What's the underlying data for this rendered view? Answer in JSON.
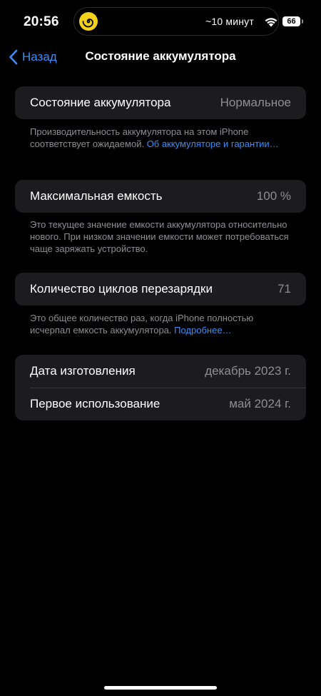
{
  "status_bar": {
    "time": "20:56",
    "timer_text": "~10 минут",
    "battery_level": "66",
    "island_icon": "spiral-icon",
    "wifi_icon": "wifi-icon"
  },
  "nav": {
    "back_label": "Назад",
    "back_icon": "chevron-left-icon",
    "title": "Состояние аккумулятора"
  },
  "battery_state": {
    "label": "Состояние аккумулятора",
    "value": "Нормальное",
    "footer_text": "Производительность аккумулятора на этом iPhone соответствует ожидаемой. ",
    "footer_link": "Об аккумуляторе и гарантии…"
  },
  "max_capacity": {
    "label": "Максимальная емкость",
    "value": "100 %",
    "footer_text": "Это текущее значение емкости аккумулятора относительно нового. При низком значении емкости может потребоваться чаще заряжать устройство."
  },
  "cycle_count": {
    "label": "Количество циклов перезарядки",
    "value": "71",
    "footer_text": "Это общее количество раз, когда iPhone полностью исчерпал емкость аккумулятора. ",
    "footer_link": "Подробнее…"
  },
  "dates": {
    "manufacture_label": "Дата изготовления",
    "manufacture_value": "декабрь 2023 г.",
    "first_use_label": "Первое использование",
    "first_use_value": "май 2024 г."
  },
  "colors": {
    "background": "#000000",
    "group_background": "#1c1c1e",
    "accent": "#3a8ef6",
    "secondary_text": "#8e8e93",
    "island_icon": "#f3d11c"
  }
}
